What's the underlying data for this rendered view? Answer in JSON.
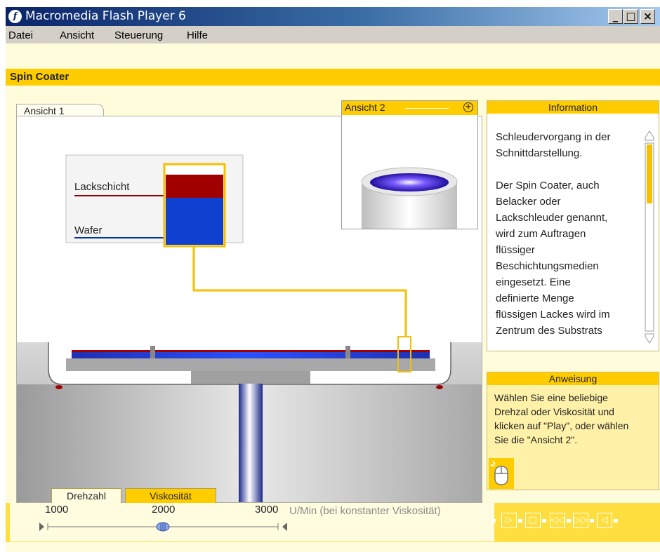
{
  "window": {
    "title": "Macromedia Flash Player 6",
    "controls": {
      "minimize": "_",
      "maximize": "□",
      "close": "×"
    }
  },
  "menu": [
    {
      "label": "Datei"
    },
    {
      "label": "Ansicht"
    },
    {
      "label": "Steuerung"
    },
    {
      "label": "Hilfe"
    }
  ],
  "header": {
    "title": "Spin Coater"
  },
  "view1": {
    "tab_label": "Ansicht 1",
    "label_lack": "Lackschicht",
    "label_wafer": "Wafer"
  },
  "view2": {
    "title": "Ansicht 2"
  },
  "info": {
    "title": "Information",
    "lines": [
      "Schleudervorgang in der",
      "Schnittdarstellung.",
      "",
      "Der Spin Coater, auch",
      "Belacker oder",
      "Lackschleuder genannt,",
      "wird zum Auftragen",
      "flüssiger",
      "Beschichtungsmedien",
      "eingesetzt. Eine",
      "definierte Menge",
      "flüssigen Lackes wird im",
      "Zentrum des Substrats"
    ]
  },
  "anweisung": {
    "title": "Anweisung",
    "lines": [
      "Wählen Sie eine beliebige",
      "Drehzal oder Viskosität und",
      "klicken auf \"Play\", oder wählen",
      "Sie die \"Ansicht 2\"."
    ]
  },
  "controls": {
    "tab_drehzahl": "Drehzahl",
    "tab_viskositaet": "Viskosität",
    "slider": {
      "min_label": "1000",
      "mid_label": "2000",
      "max_label": "3000",
      "value": 2000
    },
    "unit_text": "U/Min (bei konstanter Viskosität)"
  },
  "colors": {
    "accent": "#ffcc00",
    "lack": "#8b0000",
    "wafer": "#0033cc"
  },
  "icons": [
    "flash-icon",
    "zoom-icon",
    "mouse-icon",
    "play-icon",
    "stop-icon",
    "rewind-icon",
    "fast-forward-icon",
    "sound-icon"
  ]
}
